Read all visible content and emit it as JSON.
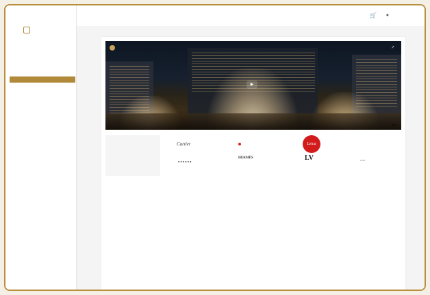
{
  "sidebar": {
    "logo_text": "",
    "user_name": "",
    "items": [
      {
        "label": ""
      },
      {
        "label": ""
      },
      {
        "label": ""
      }
    ]
  },
  "topbar": {
    "cart_icon": "cart-icon",
    "user_icon": "user-icon",
    "user_label": ""
  },
  "hero": {
    "video_title": "",
    "youtube_label": ""
  },
  "luxury": {
    "title": "",
    "link": ""
  },
  "brands": {
    "cartier": "Cartier",
    "leica": "Leica",
    "hermes": "HERMÈS",
    "lv": "LV"
  },
  "main": {
    "section_title": "",
    "paragraphs": [
      "",
      "",
      ""
    ],
    "learn_more": ""
  },
  "destinations": {
    "title": ""
  },
  "colors": {
    "accent": "#b08a3a",
    "frame_border": "#b98f3e"
  }
}
